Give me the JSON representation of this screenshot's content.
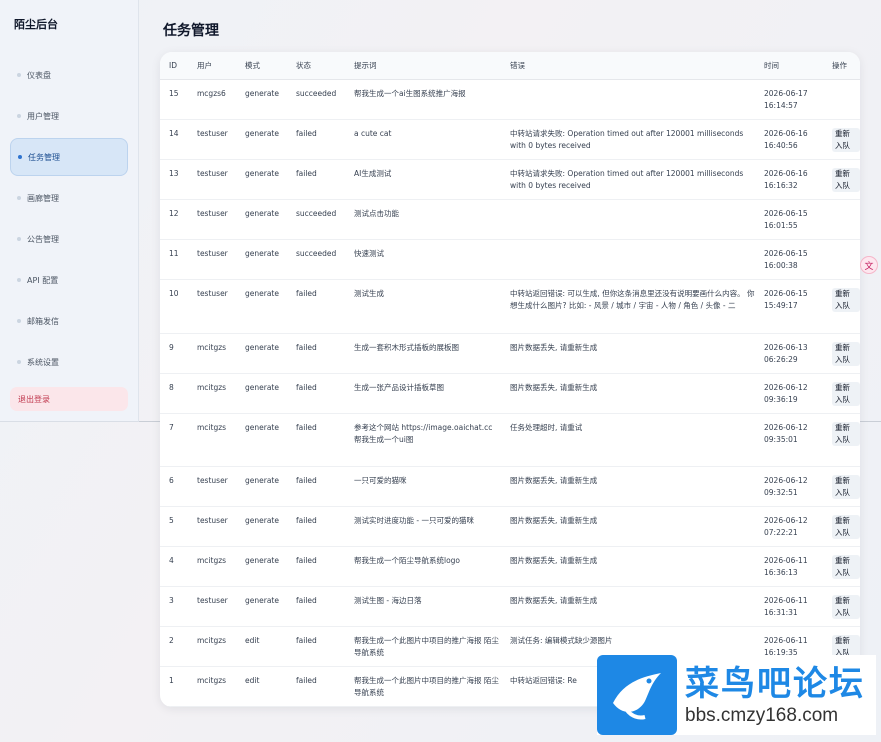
{
  "sidebar": {
    "brand": "陌尘后台",
    "items": [
      {
        "label": "仪表盘"
      },
      {
        "label": "用户管理"
      },
      {
        "label": "任务管理"
      },
      {
        "label": "画廊管理"
      },
      {
        "label": "公告管理"
      },
      {
        "label": "API 配置"
      },
      {
        "label": "邮箱发信"
      },
      {
        "label": "系统设置"
      }
    ],
    "logout": "退出登录"
  },
  "page": {
    "title": "任务管理"
  },
  "table": {
    "columns": [
      "ID",
      "用户",
      "模式",
      "状态",
      "提示词",
      "错误",
      "时间",
      "操作"
    ],
    "requeue_label": "重新入队",
    "rows": [
      {
        "id": "15",
        "user": "mcgzs6",
        "mode": "generate",
        "status": "succeeded",
        "prompt": "帮我生成一个ai生图系统推广海报",
        "error": "",
        "time": "2026-06-17 16:14:57",
        "requeue": false
      },
      {
        "id": "14",
        "user": "testuser",
        "mode": "generate",
        "status": "failed",
        "prompt": "a cute cat",
        "error": "中转站请求失败: Operation timed out after 120001 milliseconds with 0 bytes received",
        "time": "2026-06-16 16:40:56",
        "requeue": true
      },
      {
        "id": "13",
        "user": "testuser",
        "mode": "generate",
        "status": "failed",
        "prompt": "AI生成测试",
        "error": "中转站请求失败: Operation timed out after 120001 milliseconds with 0 bytes received",
        "time": "2026-06-16 16:16:32",
        "requeue": true
      },
      {
        "id": "12",
        "user": "testuser",
        "mode": "generate",
        "status": "succeeded",
        "prompt": "测试点击功能",
        "error": "",
        "time": "2026-06-15 16:01:55",
        "requeue": false
      },
      {
        "id": "11",
        "user": "testuser",
        "mode": "generate",
        "status": "succeeded",
        "prompt": "快速测试",
        "error": "",
        "time": "2026-06-15 16:00:38",
        "requeue": false
      },
      {
        "id": "10",
        "user": "testuser",
        "mode": "generate",
        "status": "failed",
        "prompt": "测试生成",
        "error": "中转站返回错误: 可以生成, 但你这条消息里还没有说明要画什么内容。 你想生成什么图片? 比如: - 风景 / 城市 / 宇宙 - 人物 / 角色 / 头像 - 二",
        "time": "2026-06-15 15:49:17",
        "requeue": true
      },
      {
        "id": "9",
        "user": "mcitgzs",
        "mode": "generate",
        "status": "failed",
        "prompt": "生成一套积木形式插板的展板图",
        "error": "图片数据丢失, 请重新生成",
        "time": "2026-06-13 06:26:29",
        "requeue": true
      },
      {
        "id": "8",
        "user": "mcitgzs",
        "mode": "generate",
        "status": "failed",
        "prompt": "生成一张产品设计插板草图",
        "error": "图片数据丢失, 请重新生成",
        "time": "2026-06-12 09:36:19",
        "requeue": true
      },
      {
        "id": "7",
        "user": "mcitgzs",
        "mode": "generate",
        "status": "failed",
        "prompt": "参考这个网站 https://image.oaichat.cc 帮我生成一个ui图",
        "error": "任务处理超时, 请重试",
        "time": "2026-06-12 09:35:01",
        "requeue": true
      },
      {
        "id": "6",
        "user": "testuser",
        "mode": "generate",
        "status": "failed",
        "prompt": "一只可爱的猫咪",
        "error": "图片数据丢失, 请重新生成",
        "time": "2026-06-12 09:32:51",
        "requeue": true
      },
      {
        "id": "5",
        "user": "testuser",
        "mode": "generate",
        "status": "failed",
        "prompt": "测试实时进度功能 - 一只可爱的猫咪",
        "error": "图片数据丢失, 请重新生成",
        "time": "2026-06-12 07:22:21",
        "requeue": true
      },
      {
        "id": "4",
        "user": "mcitgzs",
        "mode": "generate",
        "status": "failed",
        "prompt": "帮我生成一个陌尘导航系统logo",
        "error": "图片数据丢失, 请重新生成",
        "time": "2026-06-11 16:36:13",
        "requeue": true
      },
      {
        "id": "3",
        "user": "testuser",
        "mode": "generate",
        "status": "failed",
        "prompt": "测试生图 - 海边日落",
        "error": "图片数据丢失, 请重新生成",
        "time": "2026-06-11 16:31:31",
        "requeue": true
      },
      {
        "id": "2",
        "user": "mcitgzs",
        "mode": "edit",
        "status": "failed",
        "prompt": "帮我生成一个此图片中项目的推广海报 陌尘导航系统",
        "error": "测试任务: 编辑模式缺少源图片",
        "time": "2026-06-11 16:19:35",
        "requeue": true
      },
      {
        "id": "1",
        "user": "mcitgzs",
        "mode": "edit",
        "status": "failed",
        "prompt": "帮我生成一个此图片中项目的推广海报 陌尘导航系统",
        "error": "中转站返回错误: Re",
        "time": "",
        "requeue": false
      }
    ]
  },
  "watermark": {
    "title": "菜鸟吧论坛",
    "url": "bbs.cmzy168.com"
  },
  "colors": {
    "accent": "#2f74d0",
    "active_bg": "#d7e6f7",
    "logout_text": "#c0394f",
    "watermark_blue": "#1e88e5"
  }
}
